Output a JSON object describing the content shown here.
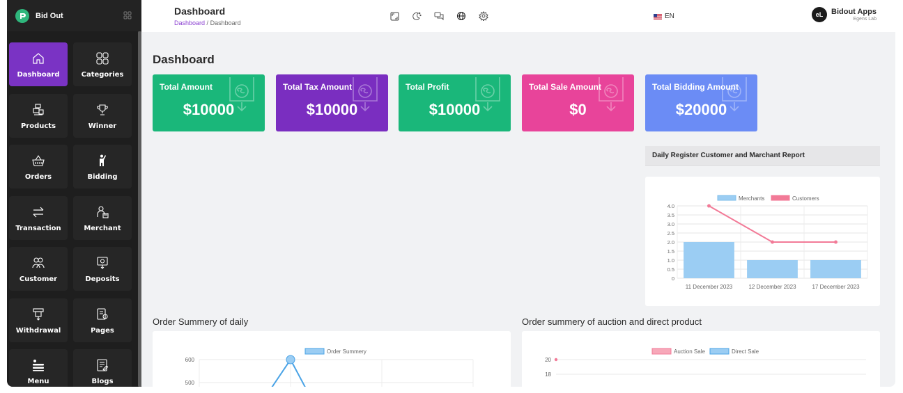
{
  "brand": {
    "name": "Bid Out"
  },
  "sidebar": {
    "items": [
      {
        "label": "Dashboard",
        "icon": "home-icon",
        "active": true
      },
      {
        "label": "Categories",
        "icon": "grid-icon"
      },
      {
        "label": "Products",
        "icon": "products-icon"
      },
      {
        "label": "Winner",
        "icon": "trophy-icon"
      },
      {
        "label": "Orders",
        "icon": "basket-icon"
      },
      {
        "label": "Bidding",
        "icon": "person-raise-hand-icon"
      },
      {
        "label": "Transaction",
        "icon": "arrows-exchange-icon"
      },
      {
        "label": "Merchant",
        "icon": "merchant-icon"
      },
      {
        "label": "Customer",
        "icon": "users-icon"
      },
      {
        "label": "Deposits",
        "icon": "deposit-icon"
      },
      {
        "label": "Withdrawal",
        "icon": "withdraw-icon"
      },
      {
        "label": "Pages",
        "icon": "pages-icon"
      },
      {
        "label": "Menu",
        "icon": "menu-icon"
      },
      {
        "label": "Blogs",
        "icon": "blog-icon"
      }
    ]
  },
  "header": {
    "title": "Dashboard",
    "breadcrumb": {
      "link": "Dashboard",
      "separator": "/",
      "current": "Dashboard"
    },
    "icons": [
      "fullscreen-icon",
      "theme-icon",
      "chat-icon",
      "globe-icon",
      "settings-icon"
    ],
    "language": "EN",
    "profile": {
      "initials": "eL",
      "name": "Bidout Apps",
      "org": "Egens Lab"
    }
  },
  "page": {
    "title": "Dashboard"
  },
  "stats": [
    {
      "label": "Total Amount",
      "value": "$10000",
      "color": "#1ab77a"
    },
    {
      "label": "Total Tax Amount",
      "value": "$10000",
      "color": "#7a2ec0"
    },
    {
      "label": "Total Profit",
      "value": "$10000",
      "color": "#1ab77a"
    },
    {
      "label": "Total Sale Amount",
      "value": "$0",
      "color": "#e8449a"
    },
    {
      "label": "Total Bidding Amount",
      "value": "$20000",
      "color": "#6b8cf5"
    }
  ],
  "register_report": {
    "title": "Daily Register Customer and Marchant Report",
    "chart_data": {
      "type": "bar",
      "categories": [
        "11 December 2023",
        "12 December 2023",
        "17 December 2023"
      ],
      "series": [
        {
          "name": "Merchants",
          "type": "bar",
          "values": [
            2,
            1,
            1
          ],
          "color": "#9bcdf3"
        },
        {
          "name": "Customers",
          "type": "line",
          "values": [
            4,
            2,
            2
          ],
          "color": "#f27a97"
        }
      ],
      "yticks": [
        "0",
        "0.5",
        "1.0",
        "1.5",
        "2.0",
        "2.5",
        "3.0",
        "3.5",
        "4.0"
      ],
      "ylim": [
        0,
        4
      ],
      "legend": "top",
      "grid": true
    }
  },
  "order_daily": {
    "title": "Order Summery of daily",
    "chart_data": {
      "type": "line",
      "series": [
        {
          "name": "Order Summery",
          "color": "#4aa3e6"
        }
      ],
      "visible_yticks": [
        "600",
        "500"
      ],
      "legend": "top",
      "grid": true
    }
  },
  "order_auction": {
    "title": "Order summery of auction and direct product",
    "chart_data": {
      "type": "line",
      "series": [
        {
          "name": "Auction Sale",
          "color": "#f27a97"
        },
        {
          "name": "Direct Sale",
          "color": "#4aa3e6"
        }
      ],
      "visible_yticks": [
        "20",
        "18"
      ],
      "legend": "top",
      "grid": true
    }
  }
}
